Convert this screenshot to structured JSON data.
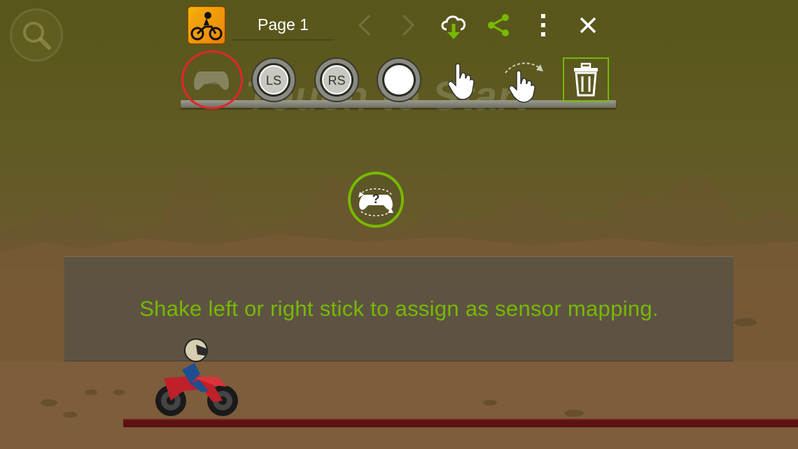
{
  "toolbar": {
    "page_label": "Page 1",
    "icons": {
      "app": "motorbike-game-icon",
      "prev": "chevron-left-icon",
      "next": "chevron-right-icon",
      "download": "cloud-download-icon",
      "share": "share-icon",
      "more": "more-vertical-icon",
      "close": "close-icon"
    }
  },
  "search": {
    "icon": "search-icon"
  },
  "tools": [
    {
      "name": "gamepad-sensor",
      "icon": "gamepad-rotate-icon",
      "selected": true
    },
    {
      "name": "left-stick",
      "label": "LS"
    },
    {
      "name": "right-stick",
      "label": "RS"
    },
    {
      "name": "button",
      "icon": "blank-button-icon"
    },
    {
      "name": "tap",
      "icon": "tap-hand-icon"
    },
    {
      "name": "swipe",
      "icon": "swipe-hand-icon"
    },
    {
      "name": "delete",
      "icon": "trash-icon"
    }
  ],
  "game_overlay_text": "Touch to Start",
  "instruction": "Shake left or right stick to assign as sensor mapping.",
  "colors": {
    "accent": "#76b900",
    "selection": "#e0262b",
    "white": "#ffffff"
  }
}
